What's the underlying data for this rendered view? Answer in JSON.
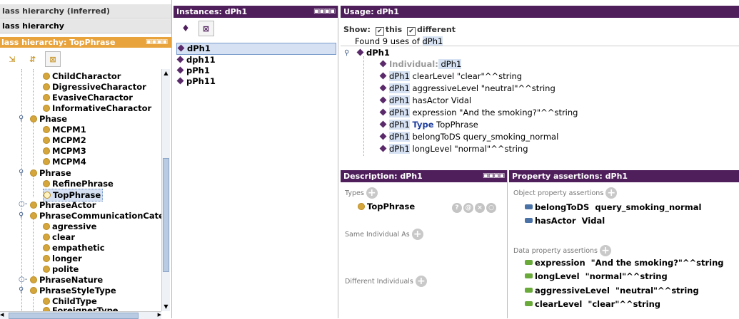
{
  "left": {
    "tab_inferred": "lass hierarchy (inferred)",
    "tab_class": "lass hierarchy",
    "panel_title": "lass hierarchy: TopPhrase",
    "tree": [
      {
        "label": "ChildCharactor"
      },
      {
        "label": "DigressiveCharactor"
      },
      {
        "label": "EvasiveCharactor"
      },
      {
        "label": "InformativeCharactor"
      },
      {
        "label": "Phase"
      },
      {
        "label": "MCPM1"
      },
      {
        "label": "MCPM2"
      },
      {
        "label": "MCPM3"
      },
      {
        "label": "MCPM4"
      },
      {
        "label": "Phrase"
      },
      {
        "label": "RefinePhrase"
      },
      {
        "label": "TopPhrase"
      },
      {
        "label": "PhraseActor"
      },
      {
        "label": "PhraseCommunicationCateg"
      },
      {
        "label": "agressive"
      },
      {
        "label": "clear"
      },
      {
        "label": "empathetic"
      },
      {
        "label": "longer"
      },
      {
        "label": "polite"
      },
      {
        "label": "PhraseNature"
      },
      {
        "label": "PhraseStyleType"
      },
      {
        "label": "ChildType"
      },
      {
        "label": "ForeignerType"
      }
    ]
  },
  "instances": {
    "title": "Instances: dPh1",
    "items": [
      "dPh1",
      "dph11",
      "pPh1",
      "pPh11"
    ]
  },
  "usage": {
    "title": "Usage: dPh1",
    "show_label": "Show:",
    "this_label": "this",
    "different_label": "different",
    "found_prefix": "Found 9 uses of ",
    "found_name": "dPh1",
    "root": "dPh1",
    "rows": [
      {
        "subject": "Individual:",
        "rest": " dPh1"
      },
      {
        "subject": "dPh1",
        "rest": " clearLevel \"clear\"^^string"
      },
      {
        "subject": "dPh1",
        "rest": " aggressiveLevel \"neutral\"^^string"
      },
      {
        "subject": "dPh1",
        "rest": " hasActor Vidal"
      },
      {
        "subject": "dPh1",
        "rest": " expression \"And the smoking?\"^^string"
      },
      {
        "subject": "dPh1",
        "kw": "Type",
        "rest": " TopPhrase"
      },
      {
        "subject": "dPh1",
        "rest": " belongToDS query_smoking_normal"
      },
      {
        "subject": "dPh1",
        "rest": " longLevel \"normal\"^^string"
      }
    ]
  },
  "description": {
    "title": "Description: dPh1",
    "types_label": "Types",
    "type_value": "TopPhrase",
    "same_label": "Same Individual As",
    "different_label": "Different Individuals"
  },
  "property": {
    "title": "Property assertions: dPh1",
    "object_label": "Object property assertions",
    "object_rows": [
      {
        "prop": "belongToDS",
        "value": "query_smoking_normal"
      },
      {
        "prop": "hasActor",
        "value": "Vidal"
      }
    ],
    "data_label": "Data property assertions",
    "data_rows": [
      {
        "prop": "expression",
        "value": "\"And the smoking?\"^^string"
      },
      {
        "prop": "longLevel",
        "value": "\"normal\"^^string"
      },
      {
        "prop": "aggressiveLevel",
        "value": "\"neutral\"^^string"
      },
      {
        "prop": "clearLevel",
        "value": "\"clear\"^^string"
      }
    ]
  }
}
